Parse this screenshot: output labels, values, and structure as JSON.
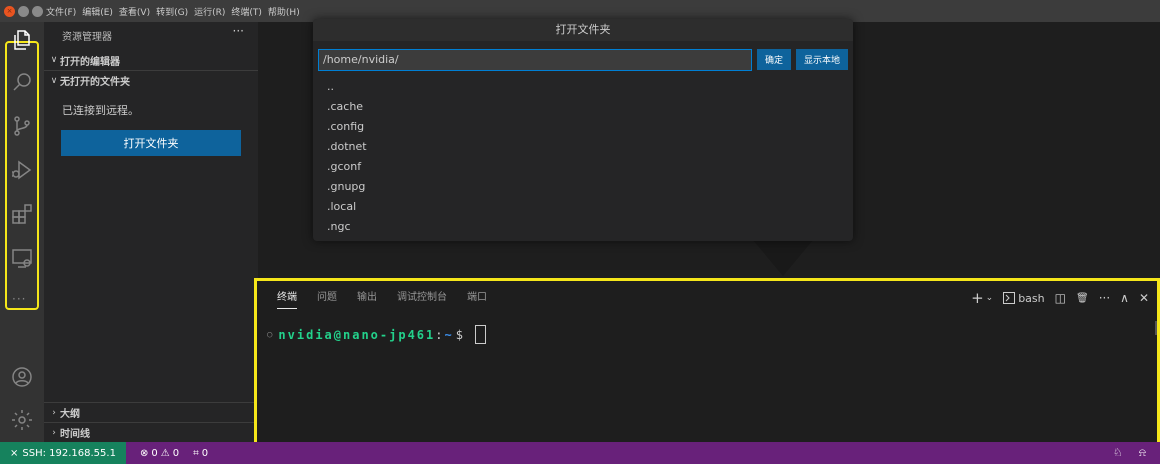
{
  "window": {
    "buttons": [
      "×",
      "–",
      "□"
    ]
  },
  "menu": [
    "文件(F)",
    "编辑(E)",
    "查看(V)",
    "转到(G)",
    "运行(R)",
    "终端(T)",
    "帮助(H)"
  ],
  "activity_bar": {
    "icons": [
      "explorer-icon",
      "search-icon",
      "source-control-icon",
      "run-debug-icon",
      "extensions-icon",
      "remote-explorer-icon",
      "account-icon",
      "settings-gear-icon"
    ],
    "more": "···",
    "highlight_color": "#f5e61a"
  },
  "sidebar": {
    "title": "资源管理器",
    "more": "···",
    "sections": {
      "open_editors": "打开的编辑器",
      "no_folder": "无打开的文件夹",
      "outline": "大纲",
      "timeline": "时间线"
    },
    "connected_text": "已连接到远程。",
    "open_folder_button": "打开文件夹"
  },
  "dialog": {
    "title": "打开文件夹",
    "input_value": "/home/nvidia/",
    "ok_button": "确定",
    "show_local_button": "显示本地",
    "items": [
      "..",
      ".cache",
      ".config",
      ".dotnet",
      ".gconf",
      ".gnupg",
      ".local",
      ".ngc"
    ]
  },
  "panel": {
    "tabs": [
      "终端",
      "问题",
      "输出",
      "调试控制台",
      "端口"
    ],
    "active_tab": "终端",
    "actions": {
      "new_terminal": "+",
      "dropdown": "⌄",
      "shell_label": "bash",
      "split": "◫",
      "kill": "🗑",
      "more": "···",
      "maximize": "∧",
      "close": "✕"
    },
    "terminal": {
      "user_host": "nvidia@nano-jp461",
      "colon": ":",
      "path": "~",
      "prompt": "$"
    },
    "highlight_color": "#f5e61a"
  },
  "status_bar": {
    "remote": "SSH: 192.168.55.1",
    "errors": "0",
    "warnings": "0",
    "ports": "0",
    "remote_bg": "#16825d",
    "bg": "#68217a"
  }
}
